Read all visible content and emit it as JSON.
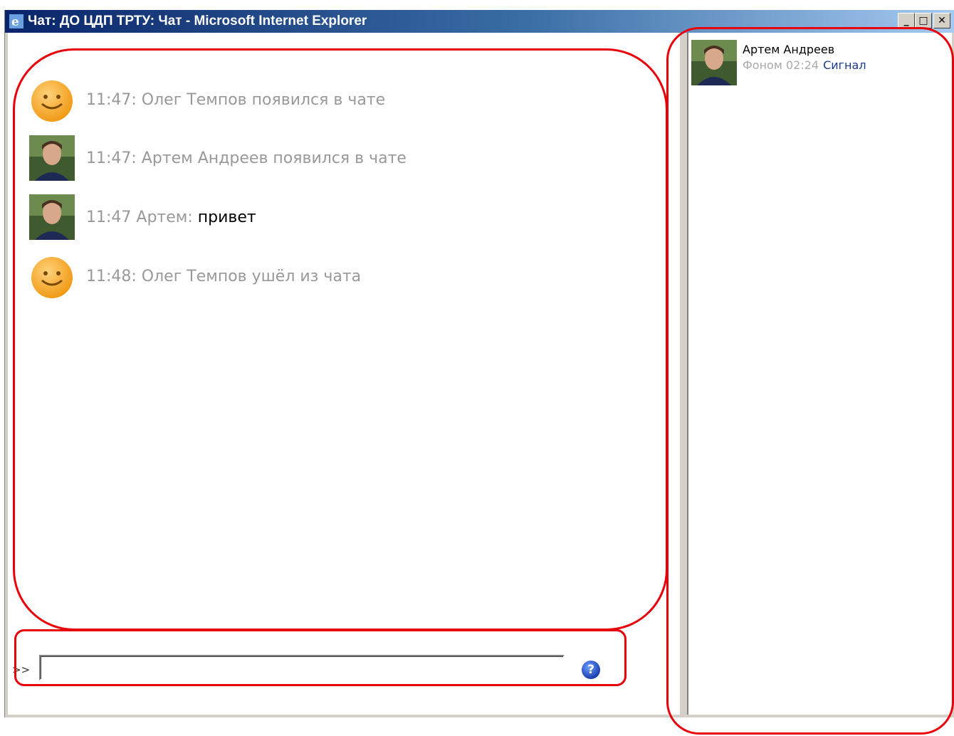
{
  "window": {
    "title": "Чат: ДО ЦДП ТРТУ: Чат - Microsoft Internet Explorer",
    "minimize_label": "_",
    "maximize_label": "□",
    "close_label": "✕"
  },
  "messages": [
    {
      "avatar": "smiley-avatar",
      "text": "11:47: Олег Темпов появился в чате",
      "body": ""
    },
    {
      "avatar": "photo-avatar",
      "text": "11:47: Артем Андреев появился в чате",
      "body": ""
    },
    {
      "avatar": "photo-avatar",
      "text": "11:47 Артем:",
      "body": " привет"
    },
    {
      "avatar": "smiley-avatar",
      "text": "11:48: Олег Темпов ушёл из чата",
      "body": ""
    }
  ],
  "input": {
    "prompt": ">>",
    "value": "",
    "help_label": "?"
  },
  "users": [
    {
      "name": "Артем Андреев",
      "status": "Фоном 02:24",
      "signal": "Сигнал"
    }
  ],
  "colors": {
    "annotation": "#e8000a",
    "system_text": "#999999",
    "link": "#1a3a8a"
  }
}
